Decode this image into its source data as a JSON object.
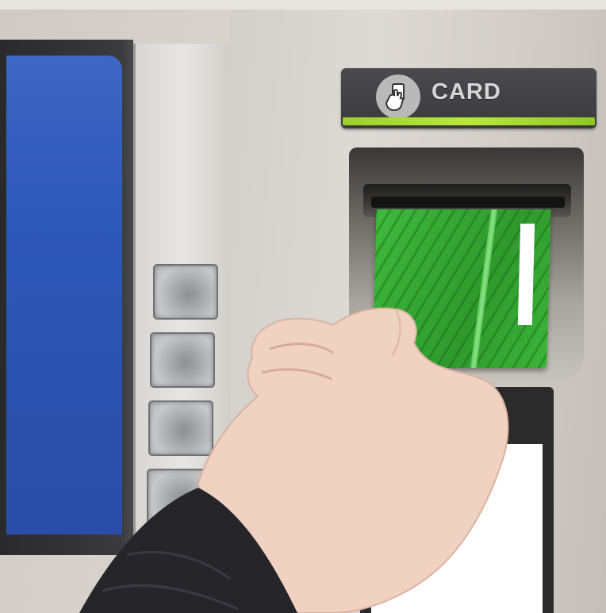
{
  "sign": {
    "label": "CARD",
    "icon": "card-insert-icon",
    "accent_color": "#a6dd30"
  },
  "screen": {
    "color": "#2d57b9"
  },
  "side_buttons": {
    "count": 4,
    "icon": "blank-key-icon"
  },
  "card": {
    "color": "#36a834",
    "stripe_color": "#ffffff"
  }
}
